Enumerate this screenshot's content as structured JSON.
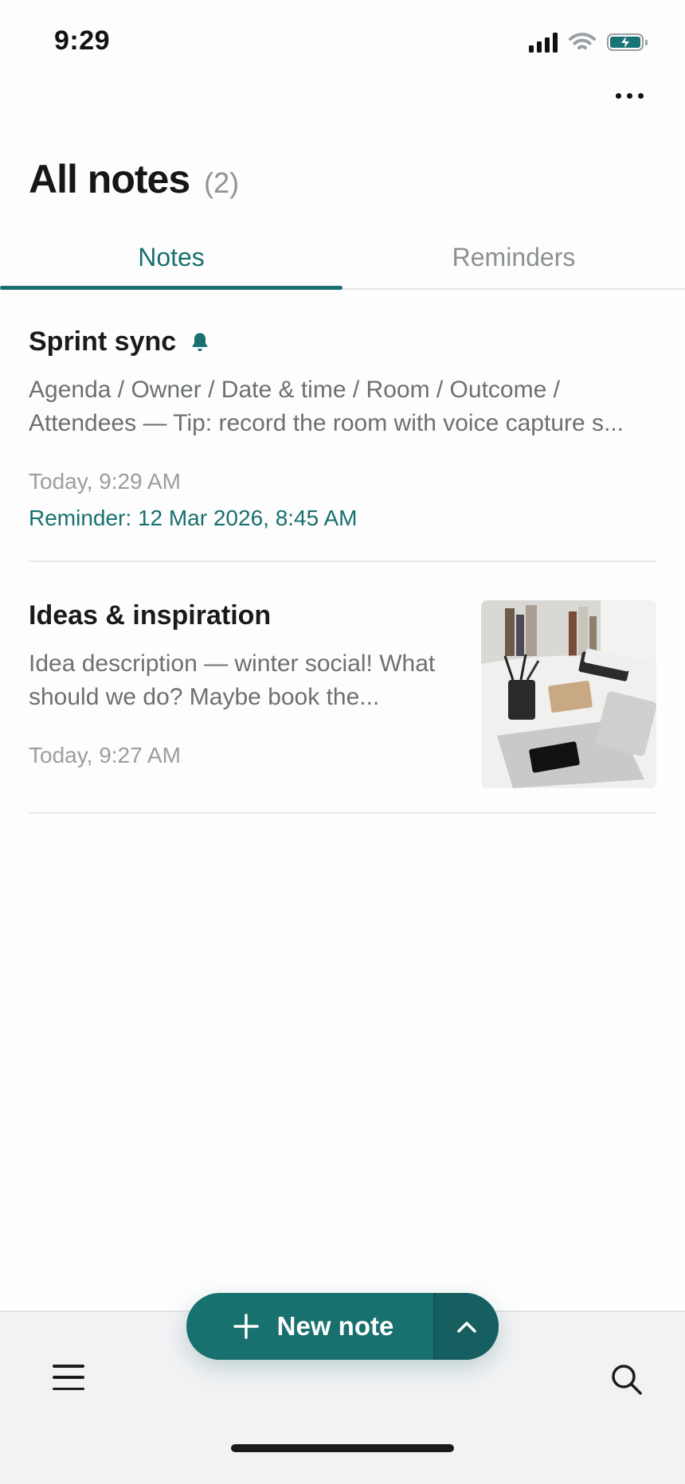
{
  "status_bar": {
    "time": "9:29"
  },
  "header": {
    "title": "All notes",
    "count": "(2)"
  },
  "tabs": [
    {
      "label": "Notes",
      "active": true
    },
    {
      "label": "Reminders",
      "active": false
    }
  ],
  "notes": [
    {
      "title": "Sprint sync",
      "has_reminder_icon": true,
      "body_line1": "Agenda / Owner / Date & time / Room / Outcome /",
      "body_line2": "Attendees — Tip: record the room with voice capture s...",
      "date": "Today, 9:29 AM",
      "reminder": "Reminder: 12 Mar 2026, 8:45 AM"
    },
    {
      "title": "Ideas & inspiration",
      "body_line1": "Idea description — winter social! What",
      "body_line2": "should we do? Maybe book the...",
      "date": "Today, 9:27 AM",
      "has_image": true
    }
  ],
  "fab": {
    "label": "New note"
  },
  "colors": {
    "accent": "#18706f",
    "bottom_bar": "#f1f2f4",
    "background": "#fdfdfd"
  },
  "icons": [
    "signal-icon",
    "wifi-icon",
    "battery-icon",
    "more-icon",
    "bell-icon",
    "plus-icon",
    "chevron-up-icon",
    "menu-icon",
    "search-icon"
  ]
}
